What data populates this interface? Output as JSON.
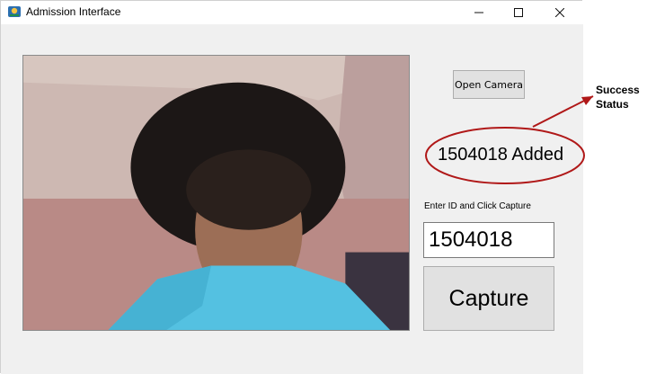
{
  "window": {
    "title": "Admission Interface",
    "icon": "app-logo-icon",
    "controls": {
      "minimize_icon": "minimize-icon",
      "maximize_icon": "maximize-icon",
      "close_icon": "close-icon"
    }
  },
  "camera": {
    "label": "camera-feed"
  },
  "buttons": {
    "open_camera": "Open Camera",
    "capture": "Capture"
  },
  "status": {
    "text": "1504018 Added"
  },
  "form": {
    "instruction": "Enter ID and Click Capture",
    "id_value": "1504018"
  },
  "annotation": {
    "line1": "Success",
    "line2": "Status",
    "color": "#b01818"
  }
}
